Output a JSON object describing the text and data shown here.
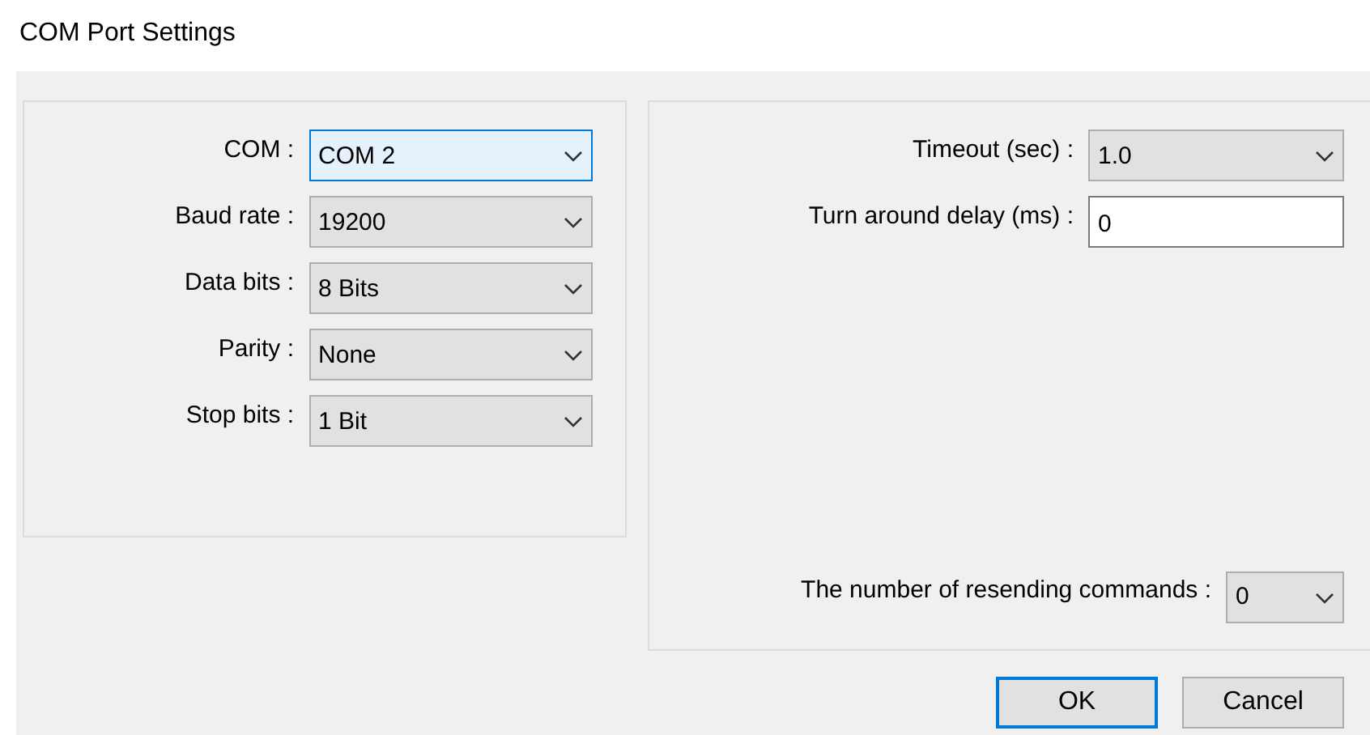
{
  "window": {
    "title": "COM Port Settings"
  },
  "port_settings": [
    {
      "label": "COM :",
      "kind": "combo",
      "value": "COM 2",
      "focused": true
    },
    {
      "label": "Baud rate :",
      "kind": "combo",
      "value": "19200",
      "focused": false
    },
    {
      "label": "Data bits :",
      "kind": "combo",
      "value": "8 Bits",
      "focused": false
    },
    {
      "label": "Parity :",
      "kind": "combo",
      "value": "None",
      "focused": false
    },
    {
      "label": "Stop bits :",
      "kind": "combo",
      "value": "1 Bit",
      "focused": false
    }
  ],
  "timing_settings": [
    {
      "label": "Timeout (sec) :",
      "kind": "combo",
      "value": "1.0",
      "focused": false
    },
    {
      "label": "Turn around delay (ms) :",
      "kind": "text",
      "value": "0",
      "focused": false
    }
  ],
  "resend_setting": {
    "label": "The number of resending commands :",
    "kind": "combo",
    "value": "0",
    "focused": false
  },
  "buttons": [
    {
      "label": "OK",
      "default": true
    },
    {
      "label": "Cancel",
      "default": false
    }
  ]
}
